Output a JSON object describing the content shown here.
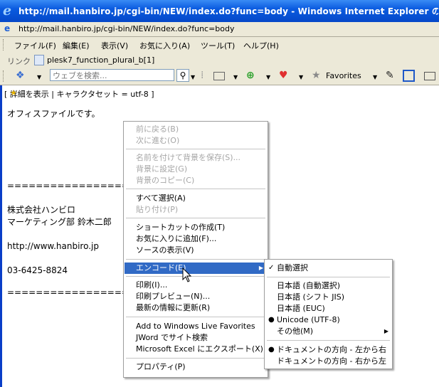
{
  "window": {
    "title": "http://mail.hanbiro.jp/cgi-bin/NEW/index.do?func=body - Windows Internet Explorer の提...",
    "address": "http://mail.hanbiro.jp/cgi-bin/NEW/index.do?func=body"
  },
  "menubar": {
    "items": [
      "ファイル(F)",
      "編集(E)",
      "表示(V)",
      "お気に入り(A)",
      "ツール(T)",
      "ヘルプ(H)"
    ]
  },
  "linkbar": {
    "label": "リンク",
    "link": "plesk7_function_plural_b[1]"
  },
  "toolbar": {
    "search_placeholder": "ウェブを検索...",
    "favorites_label": "Favorites"
  },
  "content": {
    "header": "[ 詳細を表示  | キャラクタセット = utf-8 ]",
    "body_line1": "オフィスファイルです。",
    "divider": "======================",
    "company": "株式会社ハンビロ",
    "department": "マーケティング部  鈴木二郎",
    "url": "http://www.hanbiro.jp",
    "phone": "03-6425-8824"
  },
  "context_menu": {
    "items": [
      "前に戻る(B)",
      "次に進む(O)",
      "名前を付けて背景を保存(S)...",
      "背景に設定(G)",
      "背景のコピー(C)",
      "すべて選択(A)",
      "貼り付け(P)",
      "ショートカットの作成(T)",
      "お気に入りに追加(F)...",
      "ソースの表示(V)",
      "エンコード(E)",
      "印刷(I)...",
      "印刷プレビュー(N)...",
      "最新の情報に更新(R)",
      "Add to Windows Live Favorites",
      "JWord でサイト検索",
      "Microsoft Excel にエクスポート(X)",
      "プロパティ(P)"
    ]
  },
  "encode_submenu": {
    "items": [
      "自動選択",
      "日本語 (自動選択)",
      "日本語 (シフト JIS)",
      "日本語 (EUC)",
      "Unicode (UTF-8)",
      "その他(M)",
      "ドキュメントの方向 - 左から右",
      "ドキュメントの方向 - 右から左"
    ]
  },
  "colors": {
    "titlebar": "#0a5be0",
    "highlight": "#316ac5",
    "chrome": "#ece9d8"
  }
}
